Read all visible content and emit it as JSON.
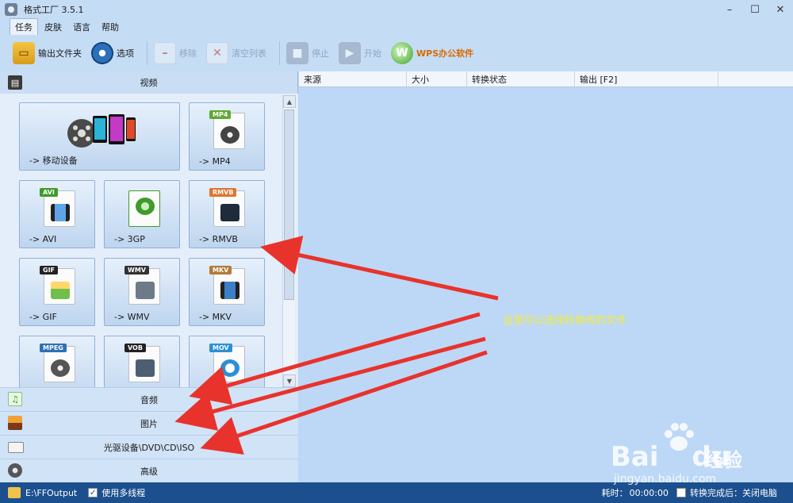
{
  "window": {
    "title": "格式工厂 3.5.1",
    "minimize": "–",
    "maximize": "☐",
    "close": "✕"
  },
  "menu": [
    "任务",
    "皮肤",
    "语言",
    "帮助"
  ],
  "toolbar": {
    "output_folder": "输出文件夹",
    "options": "选项",
    "remove": "移除",
    "clear_list": "清空列表",
    "stop": "停止",
    "start": "开始",
    "wps": "WPS办公软件"
  },
  "left": {
    "video_section": "视频",
    "tiles": [
      {
        "label": "-> 移动设备"
      },
      {
        "label": "-> MP4",
        "badge": "MP4",
        "badge_color": "#5fa832"
      },
      {
        "label": "-> AVI",
        "badge": "AVI",
        "badge_color": "#3f9b2a"
      },
      {
        "label": "-> 3GP",
        "badge": "",
        "badge_color": "#3f9b2a"
      },
      {
        "label": "-> RMVB",
        "badge": "RMVB",
        "badge_color": "#e0742d"
      },
      {
        "label": "-> GIF",
        "badge": "GIF",
        "badge_color": "#222222"
      },
      {
        "label": "-> WMV",
        "badge": "WMV",
        "badge_color": "#333333"
      },
      {
        "label": "-> MKV",
        "badge": "MKV",
        "badge_color": "#b37a3a"
      },
      {
        "label": "",
        "badge": "MPEG",
        "badge_color": "#2d6fb8"
      },
      {
        "label": "",
        "badge": "VOB",
        "badge_color": "#222222"
      },
      {
        "label": "",
        "badge": "MOV",
        "badge_color": "#2d8fd6"
      }
    ],
    "audio_section": "音频",
    "image_section": "图片",
    "disc_section": "光驱设备\\DVD\\CD\\ISO",
    "advanced_section": "高级"
  },
  "list": {
    "columns": [
      "来源",
      "大小",
      "转换状态",
      "输出 [F2]"
    ]
  },
  "status": {
    "path": "E:\\FFOutput",
    "multithread": "使用多线程",
    "elapsed_label": "耗时：",
    "elapsed_value": "00:00:00",
    "after_convert": "转换完成后：关闭电脑"
  },
  "annotation": {
    "text": "这里可以选择转换成的文件"
  },
  "watermark": {
    "brand": "Bai",
    "brand_tail": "du",
    "cn": "经验",
    "url": "jingyan.baidu.com"
  },
  "colors": {
    "arrow": "#e8332c",
    "annotation": "#f4ec3a",
    "statusbar": "#1c4f8e"
  }
}
